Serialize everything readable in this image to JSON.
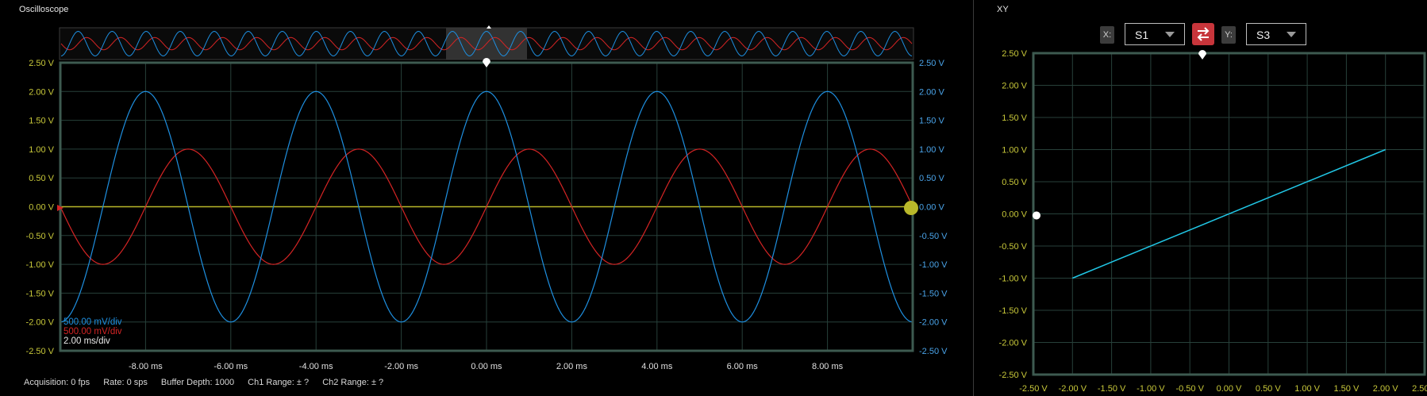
{
  "oscilloscope": {
    "title": "Oscilloscope",
    "y_ticks": [
      "2.50 V",
      "2.00 V",
      "1.50 V",
      "1.00 V",
      "0.50 V",
      "0.00 V",
      "-0.50 V",
      "-1.00 V",
      "-1.50 V",
      "-2.00 V",
      "-2.50 V"
    ],
    "x_ticks": [
      "-8.00 ms",
      "-6.00 ms",
      "-4.00 ms",
      "-2.00 ms",
      "0.00 ms",
      "2.00 ms",
      "4.00 ms",
      "6.00 ms",
      "8.00 ms"
    ],
    "legend": {
      "ch1": "500.00 mV/div",
      "ch2": "500.00 mV/div",
      "time": "2.00 ms/div"
    },
    "status": {
      "acquisition": "Acquisition: 0 fps",
      "rate": "Rate: 0 sps",
      "buffer": "Buffer Depth: 1000",
      "ch1_range": "Ch1 Range: ± ?",
      "ch2_range": "Ch2 Range: ± ?"
    }
  },
  "xy": {
    "title": "XY",
    "x_label": "X:",
    "x_value": "S1",
    "y_label": "Y:",
    "y_value": "S3",
    "y_ticks": [
      "2.50 V",
      "2.00 V",
      "1.50 V",
      "1.00 V",
      "0.50 V",
      "0.00 V",
      "-0.50 V",
      "-1.00 V",
      "-1.50 V",
      "-2.00 V",
      "-2.50 V"
    ],
    "x_ticks": [
      "-2.50 V",
      "-2.00 V",
      "-1.50 V",
      "-1.00 V",
      "-0.50 V",
      "0.00 V",
      "0.50 V",
      "1.00 V",
      "1.50 V",
      "2.00 V",
      "2.50 V"
    ]
  },
  "colors": {
    "blue": "#1e8fe0",
    "red": "#d42424",
    "trigger": "#b9b82a",
    "cyan": "#21c7e6",
    "grid": "#27403a",
    "frame": "#3d5a50",
    "tick_yellow": "#c8c83a",
    "tick_blue": "#4aa3e8"
  },
  "chart_data": [
    {
      "type": "line",
      "xlim_ms": [
        -10,
        10
      ],
      "ylim": [
        -2.5,
        2.5
      ],
      "series": [
        {
          "color": "blue",
          "amplitude_v": 2.0,
          "frequency_hz": 250,
          "phase_peak_at_ms": 0
        },
        {
          "color": "red",
          "amplitude_v": 1.0,
          "frequency_hz": 250,
          "zero_crossing_rising_at_ms": 0
        }
      ],
      "trigger_level_v": 0.0
    },
    {
      "type": "line",
      "xlim": [
        -2.5,
        2.5
      ],
      "ylim": [
        -2.5,
        2.5
      ],
      "series": [
        {
          "color": "cyan",
          "x": [
            -2.0,
            2.0
          ],
          "y": [
            -1.0,
            1.0
          ]
        }
      ]
    }
  ]
}
